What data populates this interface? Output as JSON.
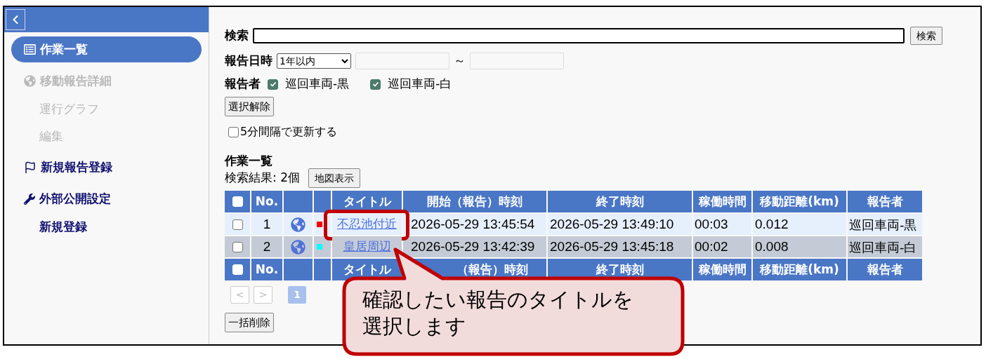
{
  "sidebar": {
    "items": [
      {
        "label": "作業一覧",
        "selected": true,
        "disabled": false
      },
      {
        "label": "移動報告詳細",
        "selected": false,
        "disabled": true,
        "children": [
          {
            "label": "運行グラフ",
            "selected": false,
            "disabled": true
          },
          {
            "label": "編集",
            "selected": false,
            "disabled": true
          }
        ]
      },
      {
        "label": "新規報告登録",
        "selected": false,
        "disabled": false
      },
      {
        "label": "外部公開設定",
        "selected": false,
        "disabled": false,
        "children": [
          {
            "label": "新規登録",
            "selected": false,
            "disabled": false
          }
        ]
      }
    ]
  },
  "search": {
    "label": "検索",
    "button": "検索"
  },
  "date_filter": {
    "label": "報告日時",
    "select": "1年以内",
    "separator": "～"
  },
  "reporters": {
    "label": "報告者",
    "options": [
      {
        "label": "巡回車両-黒",
        "checked": true
      },
      {
        "label": "巡回車両-白",
        "checked": true
      }
    ]
  },
  "clear_button": "選択解除",
  "auto_refresh": {
    "label": "5分間隔で更新する",
    "checked": false
  },
  "section_title": "作業一覧",
  "result_count": "検索結果: 2個",
  "map_button": "地図表示",
  "table": {
    "columns": [
      {
        "kind": "checkbox",
        "checked": false
      },
      {
        "kind": "text",
        "label": "No."
      },
      {
        "kind": "blank"
      },
      {
        "kind": "blank"
      },
      {
        "kind": "text",
        "label": "タイトル"
      },
      {
        "kind": "text",
        "label": "開始（報告）時刻"
      },
      {
        "kind": "text",
        "label": "終了時刻"
      },
      {
        "kind": "text",
        "label": "稼働時間"
      },
      {
        "kind": "text",
        "label": "移動距離(km)"
      },
      {
        "kind": "text",
        "label": "報告者"
      }
    ],
    "rows": [
      {
        "checked": false,
        "no": "1",
        "color": "#ff0000",
        "title": "不忍池付近",
        "highlighted": true,
        "start": "2026-05-29 13:45:54",
        "end": "2026-05-29 13:49:10",
        "duration": "00:03",
        "distance": "0.012",
        "reporter": "巡回車両-黒"
      },
      {
        "checked": false,
        "no": "2",
        "color": "#00ffff",
        "title": "皇居周辺",
        "highlighted": false,
        "start": "2026-05-29 13:42:39",
        "end": "2026-05-29 13:45:18",
        "duration": "00:02",
        "distance": "0.008",
        "reporter": "巡回車両-白"
      }
    ],
    "footer_columns": [
      {
        "kind": "checkbox",
        "checked": false
      },
      {
        "kind": "text",
        "label": "No."
      },
      {
        "kind": "blank"
      },
      {
        "kind": "blank"
      },
      {
        "kind": "text",
        "label": "タイトル"
      },
      {
        "kind": "text",
        "label": "（報告）時刻"
      },
      {
        "kind": "text",
        "label": "終了時刻"
      },
      {
        "kind": "text",
        "label": "稼働時間"
      },
      {
        "kind": "text",
        "label": "移動距離(km)"
      },
      {
        "kind": "text",
        "label": "報告者"
      }
    ]
  },
  "pagination": {
    "prev": "<",
    "next": ">",
    "pages": [
      {
        "label": "1",
        "selected": true
      }
    ]
  },
  "bulk_delete": "一括削除",
  "callout": {
    "lines": [
      "確認したい報告のタイトルを",
      "選択します"
    ]
  }
}
